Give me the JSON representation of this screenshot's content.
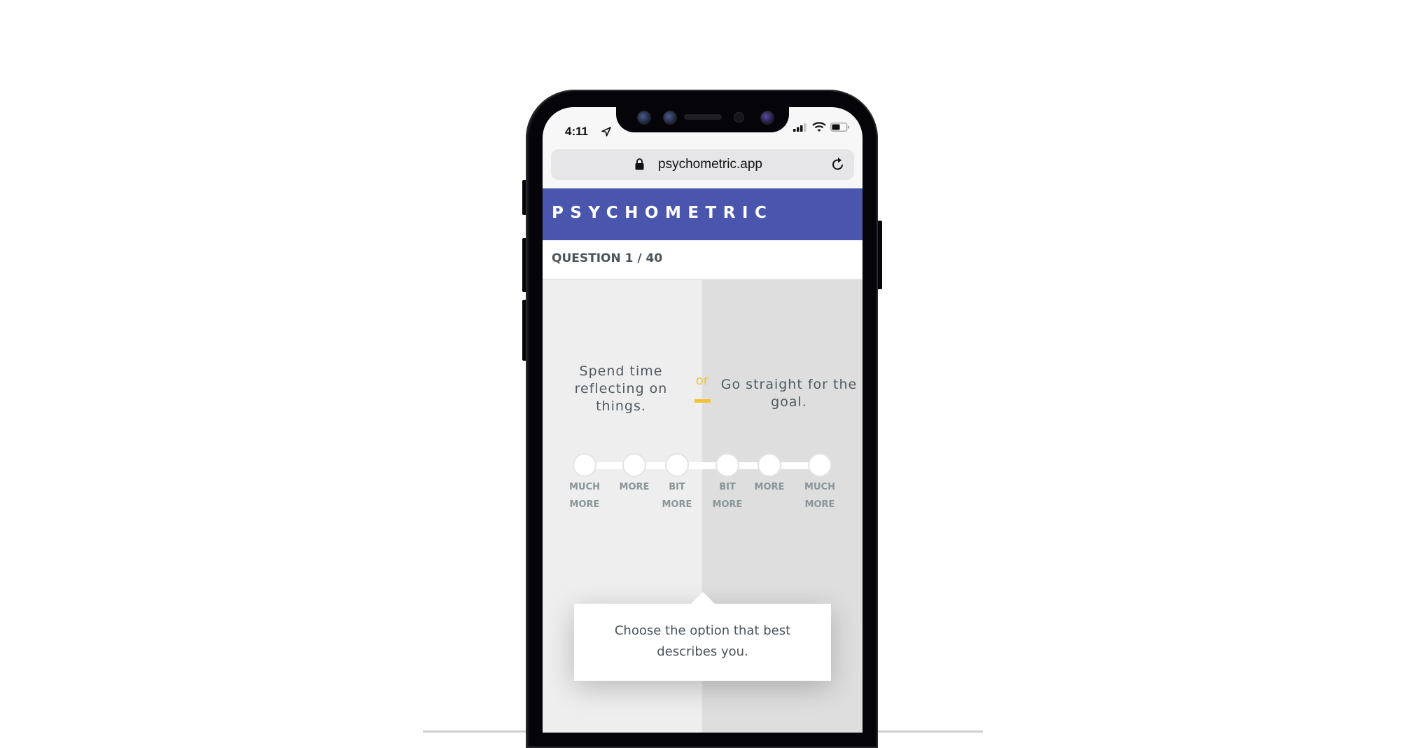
{
  "status_bar": {
    "time": "4:11",
    "icons": [
      "location-arrow-icon",
      "signal-icon",
      "wifi-icon",
      "battery-icon"
    ]
  },
  "browser": {
    "url": "psychometric.app",
    "icons": [
      "lock-icon",
      "reload-icon"
    ]
  },
  "app": {
    "brand": "PSYCHOMETRIC",
    "brand_color": "#4a56ad",
    "question_label": "QUESTION 1 / 40",
    "question_current": 1,
    "question_total": 40
  },
  "question": {
    "option_a": "Spend time reflecting on things.",
    "option_b": "Go straight for the goal.",
    "separator": "or",
    "accent_color": "#f2c434"
  },
  "scale": {
    "options": [
      {
        "line1": "MUCH",
        "line2": "MORE"
      },
      {
        "line1": "MORE",
        "line2": ""
      },
      {
        "line1": "BIT",
        "line2": "MORE"
      },
      {
        "line1": "BIT",
        "line2": "MORE"
      },
      {
        "line1": "MORE",
        "line2": ""
      },
      {
        "line1": "MUCH",
        "line2": "MORE"
      }
    ],
    "selected": null
  },
  "tooltip": {
    "text": "Choose the option that best describes you."
  }
}
